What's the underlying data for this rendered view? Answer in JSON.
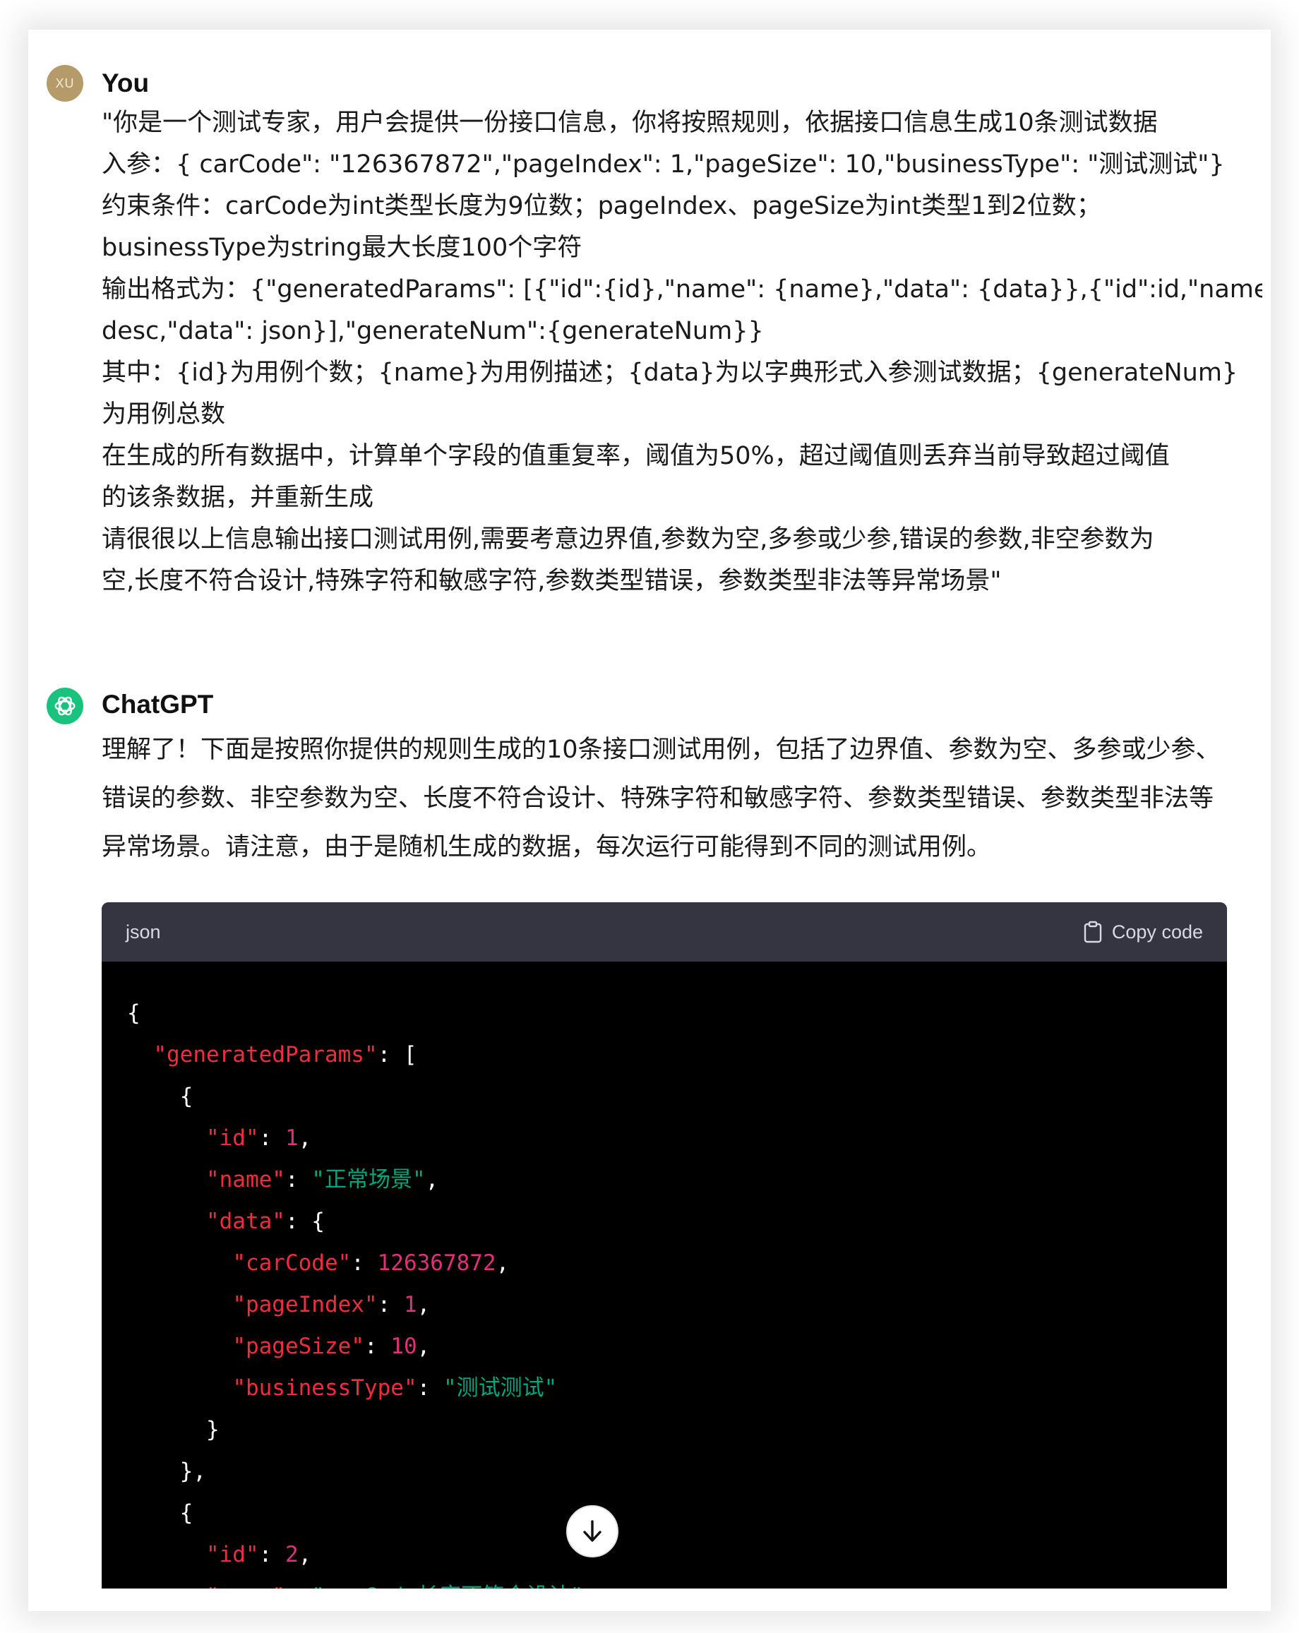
{
  "conversation": {
    "user": {
      "avatar_initials": "XU",
      "author": "You",
      "lines": [
        "\"你是一个测试专家，用户会提供一份接口信息，你将按照规则，依据接口信息生成10条测试数据",
        "入参：{ carCode\": \"126367872\",\"pageIndex\": 1,\"pageSize\": 10,\"businessType\": \"测试测试\"}",
        "约束条件：carCode为int类型长度为9位数；pageIndex、pageSize为int类型1到2位数；",
        "businessType为string最大长度100个字符",
        "输出格式为：{\"generatedParams\": [{\"id\":{id},\"name\": {name},\"data\": {data}},{\"id\":id,\"name\":",
        "desc,\"data\": json}],\"generateNum\":{generateNum}}",
        "其中：{id}为用例个数；{name}为用例描述；{data}为以字典形式入参测试数据；{generateNum}",
        "为用例总数",
        "在生成的所有数据中，计算单个字段的值重复率，阈值为50%，超过阈值则丢弃当前导致超过阈值",
        "的该条数据，并重新生成",
        "请很很以上信息输出接口测试用例,需要考意边界值,参数为空,多参或少参,错误的参数,非空参数为",
        "空,长度不符合设计,特殊字符和敏感字符,参数类型错误，参数类型非法等异常场景\""
      ]
    },
    "assistant": {
      "author": "ChatGPT",
      "lines": [
        "理解了！下面是按照你提供的规则生成的10条接口测试用例，包括了边界值、参数为空、多参或少参、",
        "错误的参数、非空参数为空、长度不符合设计、特殊字符和敏感字符、参数类型错误、参数类型非法等",
        "异常场景。请注意，由于是随机生成的数据，每次运行可能得到不同的测试用例。"
      ],
      "code": {
        "language": "json",
        "copy_label": "Copy code",
        "lines": [
          [
            {
              "t": "p",
              "v": "{"
            }
          ],
          [
            {
              "t": "p",
              "v": "  "
            },
            {
              "t": "k",
              "v": "\"generatedParams\""
            },
            {
              "t": "p",
              "v": ": ["
            }
          ],
          [
            {
              "t": "p",
              "v": "    {"
            }
          ],
          [
            {
              "t": "p",
              "v": "      "
            },
            {
              "t": "k",
              "v": "\"id\""
            },
            {
              "t": "p",
              "v": ": "
            },
            {
              "t": "n",
              "v": "1"
            },
            {
              "t": "p",
              "v": ","
            }
          ],
          [
            {
              "t": "p",
              "v": "      "
            },
            {
              "t": "k",
              "v": "\"name\""
            },
            {
              "t": "p",
              "v": ": "
            },
            {
              "t": "s",
              "v": "\"正常场景\""
            },
            {
              "t": "p",
              "v": ","
            }
          ],
          [
            {
              "t": "p",
              "v": "      "
            },
            {
              "t": "k",
              "v": "\"data\""
            },
            {
              "t": "p",
              "v": ": {"
            }
          ],
          [
            {
              "t": "p",
              "v": "        "
            },
            {
              "t": "k",
              "v": "\"carCode\""
            },
            {
              "t": "p",
              "v": ": "
            },
            {
              "t": "n",
              "v": "126367872"
            },
            {
              "t": "p",
              "v": ","
            }
          ],
          [
            {
              "t": "p",
              "v": "        "
            },
            {
              "t": "k",
              "v": "\"pageIndex\""
            },
            {
              "t": "p",
              "v": ": "
            },
            {
              "t": "n",
              "v": "1"
            },
            {
              "t": "p",
              "v": ","
            }
          ],
          [
            {
              "t": "p",
              "v": "        "
            },
            {
              "t": "k",
              "v": "\"pageSize\""
            },
            {
              "t": "p",
              "v": ": "
            },
            {
              "t": "n",
              "v": "10"
            },
            {
              "t": "p",
              "v": ","
            }
          ],
          [
            {
              "t": "p",
              "v": "        "
            },
            {
              "t": "k",
              "v": "\"businessType\""
            },
            {
              "t": "p",
              "v": ": "
            },
            {
              "t": "s",
              "v": "\"测试测试\""
            }
          ],
          [
            {
              "t": "p",
              "v": "      }"
            }
          ],
          [
            {
              "t": "p",
              "v": "    },"
            }
          ],
          [
            {
              "t": "p",
              "v": "    {"
            }
          ],
          [
            {
              "t": "p",
              "v": "      "
            },
            {
              "t": "k",
              "v": "\"id\""
            },
            {
              "t": "p",
              "v": ": "
            },
            {
              "t": "n",
              "v": "2"
            },
            {
              "t": "p",
              "v": ","
            }
          ],
          [
            {
              "t": "p",
              "v": "      "
            },
            {
              "t": "k",
              "v": "\"name\""
            },
            {
              "t": "p",
              "v": ": "
            },
            {
              "t": "s",
              "v": "\"carCode长度不符合设计\""
            }
          ]
        ]
      }
    },
    "scroll_button_icon": "arrow-down-icon"
  }
}
